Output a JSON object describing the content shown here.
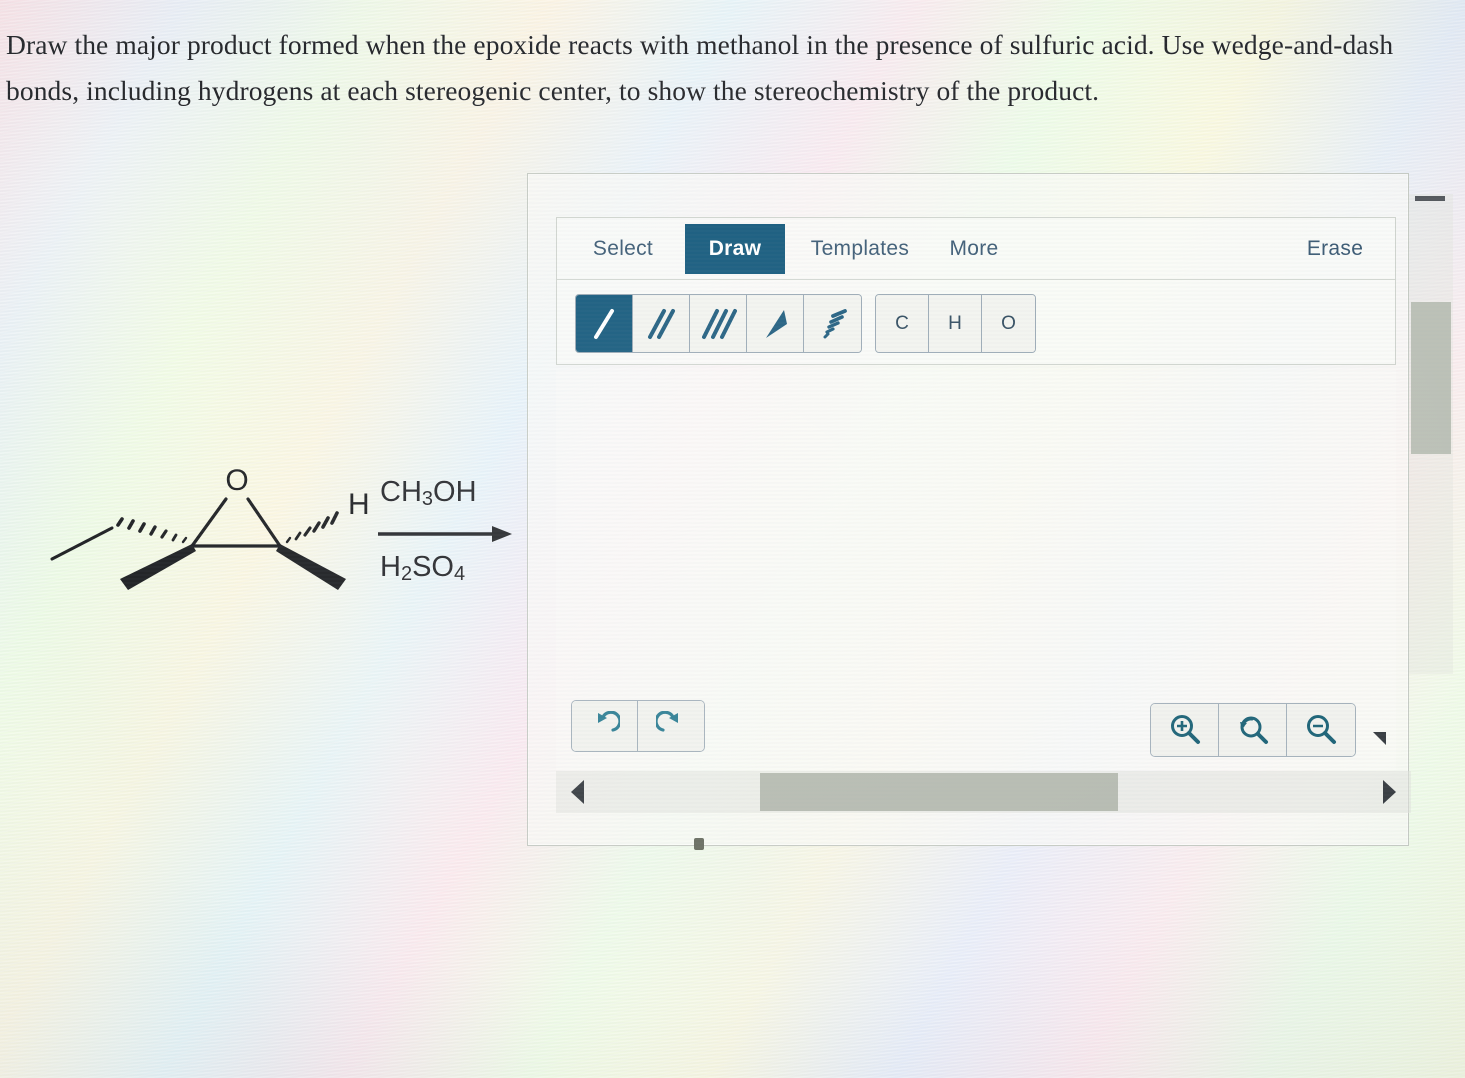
{
  "question": {
    "text": "Draw the major product formed when the epoxide reacts with methanol in the presence of sulfuric acid. Use wedge-and-dash bonds, including hydrogens at each stereogenic center, to show the stereochemistry of the product."
  },
  "reaction": {
    "reagent_above_arrow": "CH3OH",
    "reagent_below_arrow": "H2SO4",
    "arrow": "reaction-arrow-right",
    "substrate": {
      "name": "epoxide",
      "ring_heteroatom_label": "O",
      "stereocenter_hydrogen_label": "H",
      "bonds": [
        {
          "type": "hash",
          "from": "left-carbon",
          "to": "ethyl-chain",
          "direction": "up-left"
        },
        {
          "type": "plain",
          "from": "ethyl-chain-bend",
          "to": "terminal-methyl",
          "direction": "down-left"
        },
        {
          "type": "wedge",
          "from": "left-carbon",
          "to": "methyl",
          "direction": "down-left"
        },
        {
          "type": "plain",
          "from": "left-carbon",
          "to": "ring-oxygen",
          "direction": "up-right"
        },
        {
          "type": "plain",
          "from": "right-carbon",
          "to": "ring-oxygen",
          "direction": "up-left"
        },
        {
          "type": "plain",
          "from": "left-carbon",
          "to": "right-carbon",
          "direction": "right"
        },
        {
          "type": "hash",
          "from": "right-carbon",
          "to": "hydrogen",
          "direction": "up-right"
        },
        {
          "type": "wedge",
          "from": "right-carbon",
          "to": "methyl",
          "direction": "down-right"
        }
      ]
    }
  },
  "editor": {
    "tabs": [
      {
        "id": "select",
        "label": "Select",
        "active": false
      },
      {
        "id": "draw",
        "label": "Draw",
        "active": true
      },
      {
        "id": "templates",
        "label": "Templates",
        "active": false
      },
      {
        "id": "more",
        "label": "More",
        "active": false
      }
    ],
    "erase_label": "Erase",
    "bond_tools": [
      {
        "id": "single",
        "icon": "single-bond-icon",
        "selected": true
      },
      {
        "id": "double",
        "icon": "double-bond-icon",
        "selected": false
      },
      {
        "id": "triple",
        "icon": "triple-bond-icon",
        "selected": false
      },
      {
        "id": "wedge",
        "icon": "wedge-bond-icon",
        "selected": false
      },
      {
        "id": "hash",
        "icon": "hash-bond-icon",
        "selected": false
      }
    ],
    "element_tools": [
      {
        "id": "carbon",
        "label": "C"
      },
      {
        "id": "hydrogen",
        "label": "H"
      },
      {
        "id": "oxygen",
        "label": "O"
      }
    ],
    "history_tools": [
      {
        "id": "undo",
        "icon": "undo-arrow-icon"
      },
      {
        "id": "redo",
        "icon": "redo-arrow-icon"
      }
    ],
    "zoom_tools": [
      {
        "id": "zoom-in",
        "icon": "magnifier-plus-icon"
      },
      {
        "id": "zoom-reset",
        "icon": "magnifier-reset-icon"
      },
      {
        "id": "zoom-out",
        "icon": "magnifier-minus-icon"
      }
    ],
    "canvas_content": "",
    "scrollbars": {
      "horizontal_arrow_left": "triangle-left-icon",
      "horizontal_arrow_right": "triangle-right-icon",
      "resize_handle": "resize-corner-icon"
    }
  },
  "colors": {
    "accent": "#14597c",
    "tab_text": "#3c5b74",
    "panel_border": "#c6cbc4",
    "button_border": "#9aa9b5",
    "scroll_thumb": "#b7bcb2",
    "structure_ink": "#1d1f22"
  }
}
